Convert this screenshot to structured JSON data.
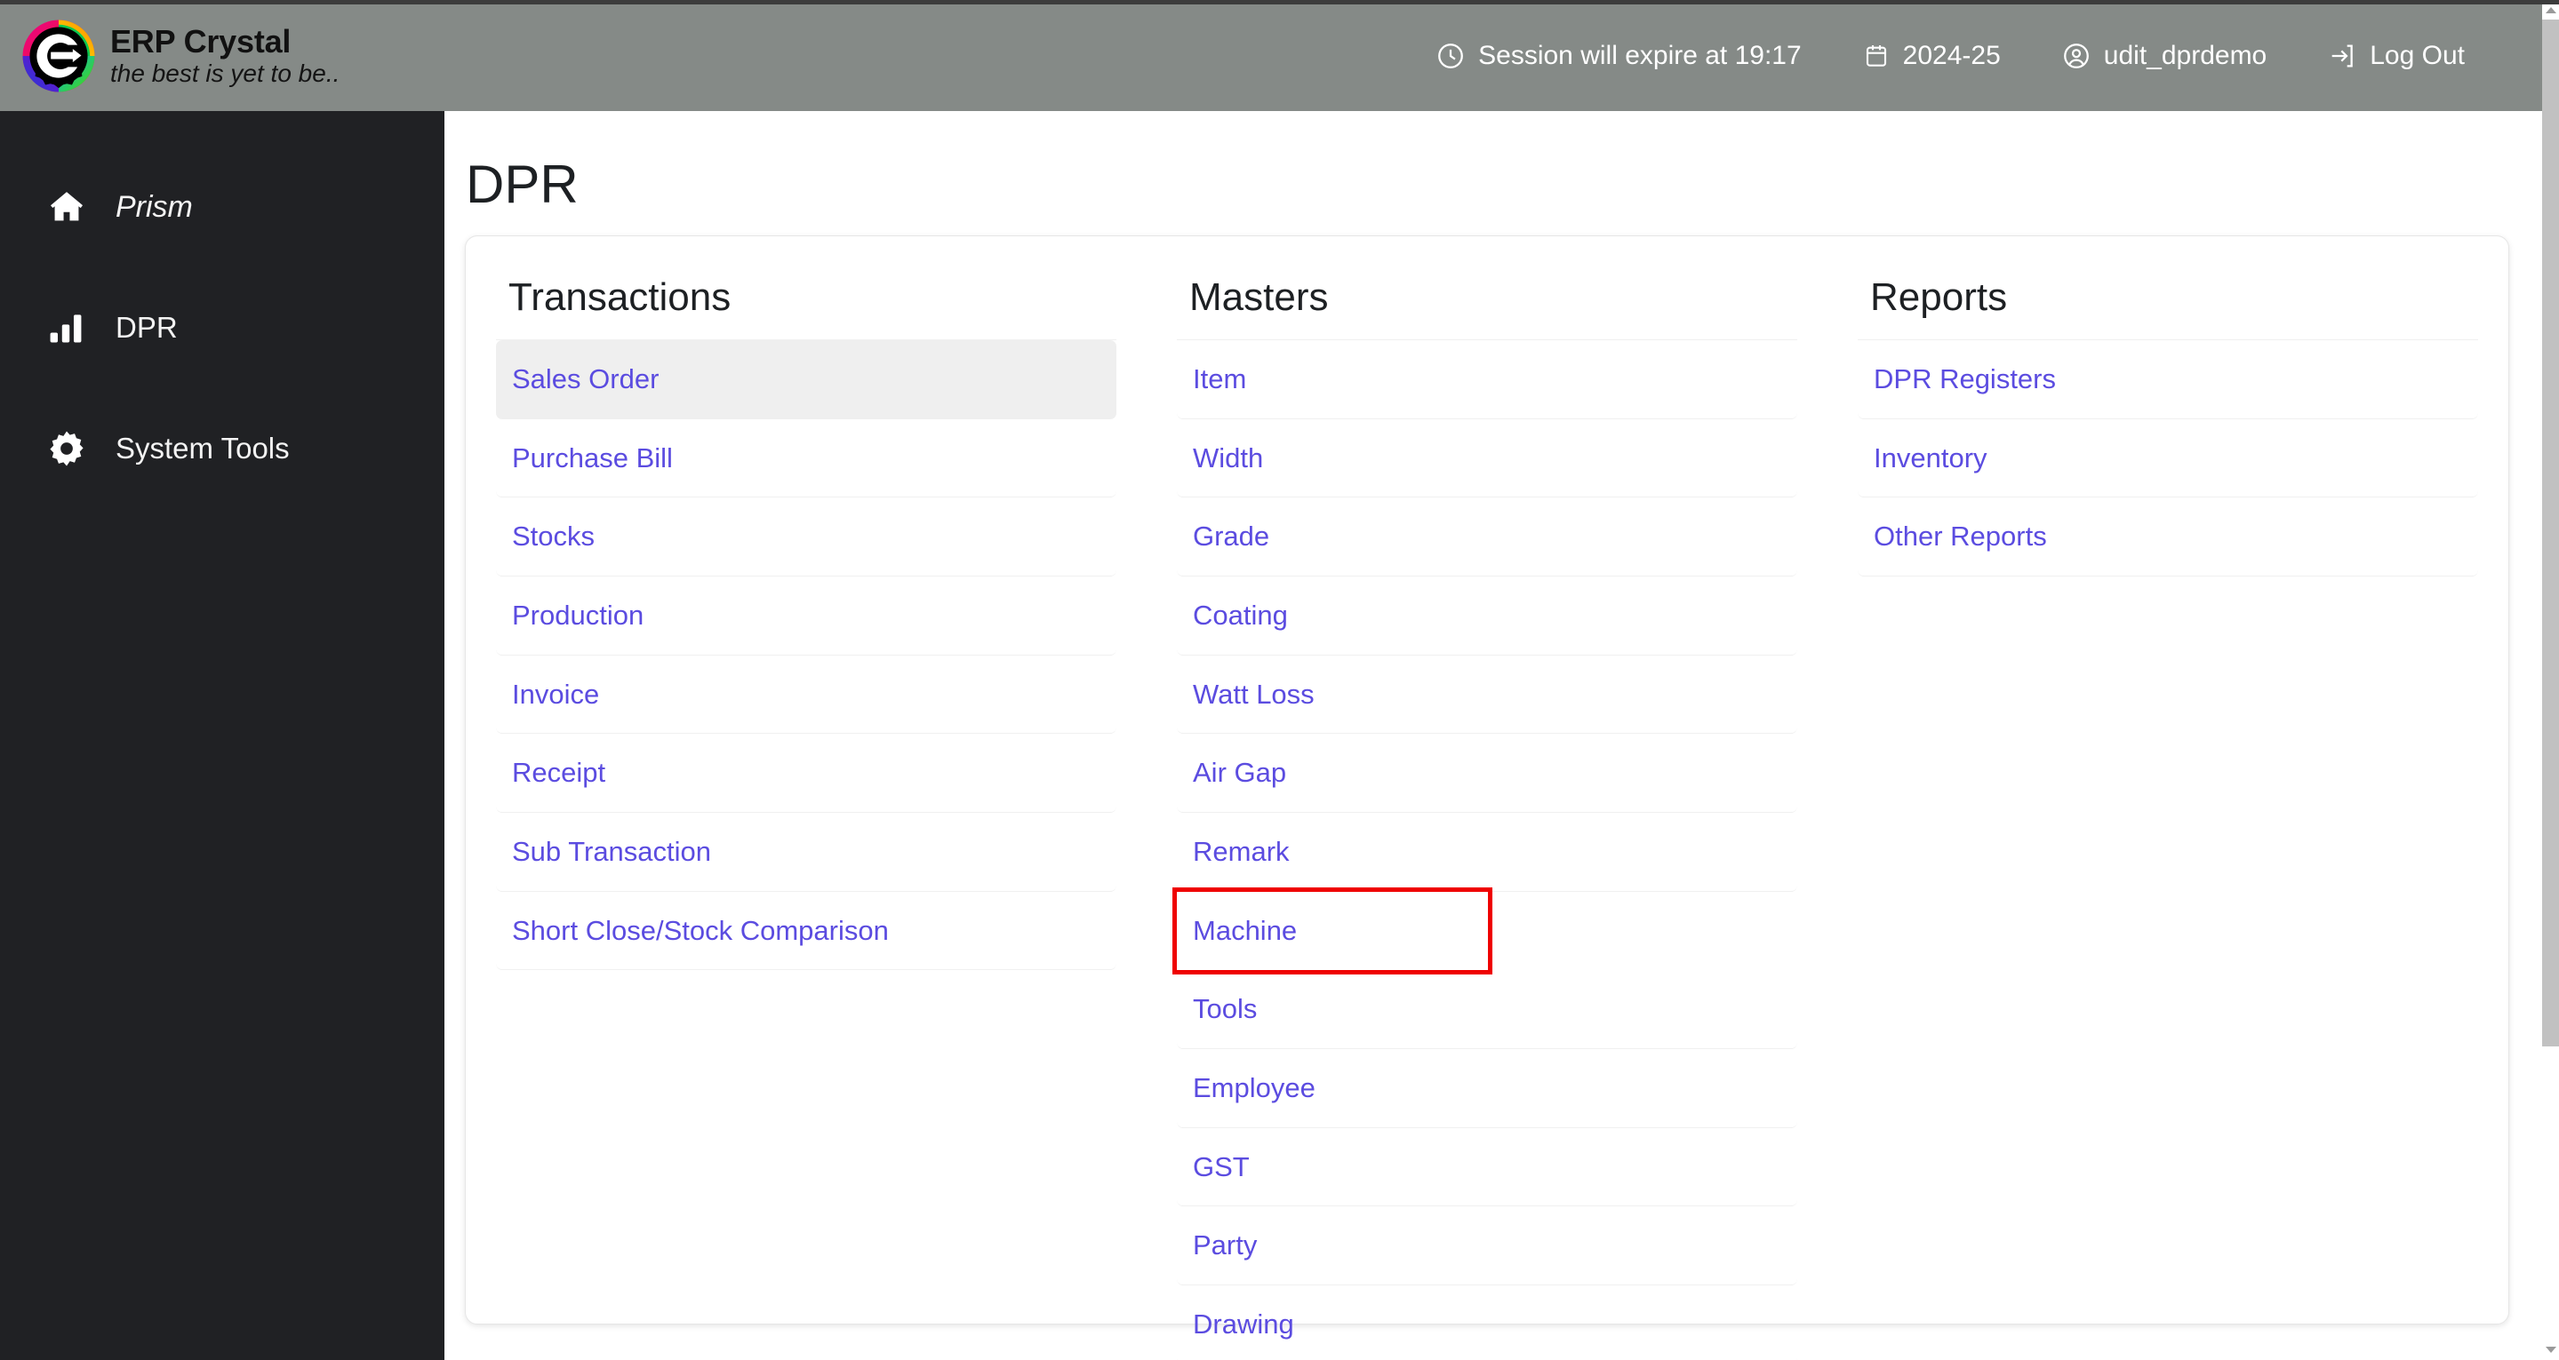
{
  "header": {
    "brand_title": "ERP Crystal",
    "brand_tagline": "the best is yet to be..",
    "nav": [
      {
        "icon": "clock-icon",
        "label": "Session will expire at 19:17"
      },
      {
        "icon": "calendar-icon",
        "label": "2024-25"
      },
      {
        "icon": "user-icon",
        "label": "udit_dprdemo"
      },
      {
        "icon": "logout-icon",
        "label": "Log Out"
      }
    ]
  },
  "sidebar": {
    "items": [
      {
        "icon": "home-icon",
        "label": "Prism"
      },
      {
        "icon": "bar-chart-icon",
        "label": "DPR"
      },
      {
        "icon": "gear-icon",
        "label": "System Tools"
      }
    ]
  },
  "main": {
    "page_title": "DPR",
    "columns": [
      {
        "title": "Transactions",
        "items": [
          {
            "label": "Sales Order",
            "state": "active"
          },
          {
            "label": "Purchase Bill",
            "state": "normal"
          },
          {
            "label": "Stocks",
            "state": "normal"
          },
          {
            "label": "Production",
            "state": "normal"
          },
          {
            "label": "Invoice",
            "state": "normal"
          },
          {
            "label": "Receipt",
            "state": "normal"
          },
          {
            "label": "Sub Transaction",
            "state": "normal"
          },
          {
            "label": "Short Close/Stock Comparison",
            "state": "normal"
          }
        ]
      },
      {
        "title": "Masters",
        "items": [
          {
            "label": "Item",
            "state": "normal"
          },
          {
            "label": "Width",
            "state": "normal"
          },
          {
            "label": "Grade",
            "state": "normal"
          },
          {
            "label": "Coating",
            "state": "normal"
          },
          {
            "label": "Watt Loss",
            "state": "normal"
          },
          {
            "label": "Air Gap",
            "state": "normal"
          },
          {
            "label": "Remark",
            "state": "normal"
          },
          {
            "label": "Machine",
            "state": "highlighted"
          },
          {
            "label": "Tools",
            "state": "normal"
          },
          {
            "label": "Employee",
            "state": "normal"
          },
          {
            "label": "GST",
            "state": "normal"
          },
          {
            "label": "Party",
            "state": "normal"
          },
          {
            "label": "Drawing",
            "state": "normal"
          }
        ]
      },
      {
        "title": "Reports",
        "items": [
          {
            "label": "DPR Registers",
            "state": "normal"
          },
          {
            "label": "Inventory",
            "state": "normal"
          },
          {
            "label": "Other Reports",
            "state": "normal"
          }
        ]
      }
    ]
  },
  "colors": {
    "header_bg": "#858a87",
    "sidebar_bg": "#202124",
    "link": "#5b4ce0",
    "highlight_box": "#ef0000",
    "active_row": "#efefef"
  }
}
